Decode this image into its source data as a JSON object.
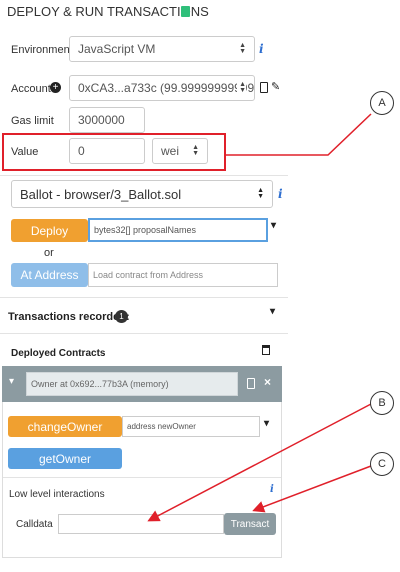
{
  "header": {
    "title": "DEPLOY & RUN TRANSACTIONS"
  },
  "environment": {
    "label": "Environment",
    "value": "JavaScript VM"
  },
  "account": {
    "label": "Account",
    "value": "0xCA3...a733c (99.99999999999"
  },
  "gas_limit": {
    "label": "Gas limit",
    "value": "3000000"
  },
  "value": {
    "label": "Value",
    "amount": "0",
    "unit": "wei"
  },
  "contract": {
    "selected": "Ballot - browser/3_Ballot.sol"
  },
  "deploy": {
    "button": "Deploy",
    "params": "bytes32[] proposalNames"
  },
  "or_text": "or",
  "at_address": {
    "button": "At Address",
    "placeholder": "Load contract from Address"
  },
  "transactions": {
    "label": "Transactions recorded:",
    "count": "1"
  },
  "deployed": {
    "title": "Deployed Contracts",
    "instance": "Owner at 0x692...77b3A (memory)",
    "change_owner": {
      "button": "changeOwner",
      "params": "address newOwner"
    },
    "get_owner": {
      "button": "getOwner"
    },
    "low_level": "Low level interactions",
    "calldata_label": "Calldata",
    "transact": "Transact"
  },
  "callouts": {
    "a": "A",
    "b": "B",
    "c": "C"
  },
  "colors": {
    "highlight": "#e0202a",
    "orange": "#f0a030",
    "blue": "#5aa0e0",
    "gray": "#8c9ba1"
  }
}
